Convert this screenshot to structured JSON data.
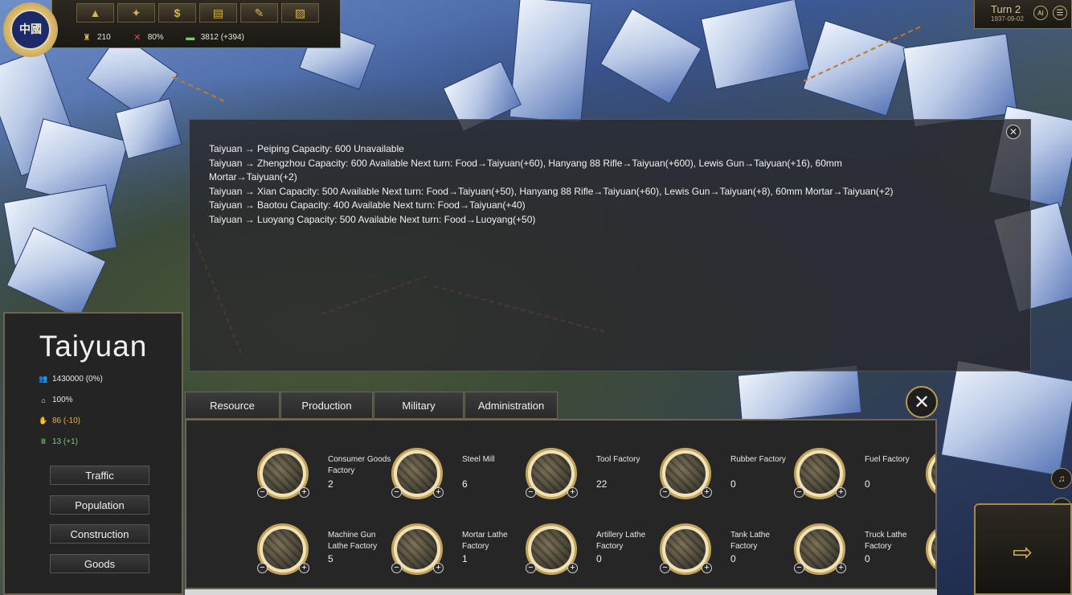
{
  "colors": {
    "gold": "#c3a35a",
    "food_warning": "#e8b04a",
    "positive_green": "#6fd36a",
    "panel_bg": "#262626"
  },
  "topbar": {
    "emblem_text": "中國",
    "icons": [
      "factory-icon",
      "eagle-icon",
      "dollar-icon",
      "map-icon",
      "hammer-icon",
      "chart-icon"
    ],
    "icon_glyphs": [
      "▲",
      "✦",
      "$",
      "▤",
      "✎",
      "▨"
    ],
    "stats": [
      {
        "icon": "industry-icon",
        "glyph": "♜",
        "value": "210"
      },
      {
        "icon": "crossed-swords-icon",
        "glyph": "✕",
        "value": "80%"
      },
      {
        "icon": "money-icon",
        "glyph": "▬",
        "value": "3812 (+394)"
      }
    ]
  },
  "turn": {
    "title": "Turn 2",
    "date": "1937-09-02",
    "ai_label": "AI",
    "menu_glyph": "☰"
  },
  "log": {
    "close_glyph": "✕",
    "lines": [
      "Taiyuan → Peiping  Capacity: 600  Unavailable",
      "Taiyuan → Zhengzhou  Capacity: 600  Available  Next turn: Food→Taiyuan(+60), Hanyang 88 Rifle→Taiyuan(+600), Lewis Gun→Taiyuan(+16), 60mm",
      "Mortar→Taiyuan(+2)",
      "Taiyuan → Xian  Capacity: 500  Available  Next turn: Food→Taiyuan(+50), Hanyang 88 Rifle→Taiyuan(+60), Lewis Gun→Taiyuan(+8), 60mm Mortar→Taiyuan(+2)",
      "Taiyuan → Baotou  Capacity: 400  Available  Next turn: Food→Taiyuan(+40)",
      "Taiyuan → Luoyang  Capacity: 500  Available  Next turn: Food→Luoyang(+50)"
    ]
  },
  "city": {
    "name": "Taiyuan",
    "stats": [
      {
        "icon": "population-icon",
        "glyph": "👥",
        "value": "1430000 (0%)",
        "color": "#e8e8e8"
      },
      {
        "icon": "loyalty-icon",
        "glyph": "⌂",
        "value": "100%",
        "color": "#e8e8e8"
      },
      {
        "icon": "food-icon",
        "glyph": "✋",
        "value": "86 (-10)",
        "color": "#e8b04a"
      },
      {
        "icon": "supply-icon",
        "glyph": "Ⅲ",
        "value": "13 (+1)",
        "color": "#6fd36a"
      }
    ],
    "buttons": [
      "Traffic",
      "Population",
      "Construction",
      "Goods"
    ]
  },
  "tabs": [
    "Resource",
    "Production",
    "Military",
    "Administration"
  ],
  "panel_close_glyph": "✕",
  "buildings": [
    {
      "name": "Consumer Goods Factory",
      "count": "2"
    },
    {
      "name": "Steel Mill",
      "count": "6"
    },
    {
      "name": "Tool Factory",
      "count": "22"
    },
    {
      "name": "Rubber Factory",
      "count": "0"
    },
    {
      "name": "Fuel Factory",
      "count": "0"
    },
    {
      "name": "Machine Gun Lathe Factory",
      "count": "5"
    },
    {
      "name": "Mortar Lathe Factory",
      "count": "1"
    },
    {
      "name": "Artillery Lathe Factory",
      "count": "0"
    },
    {
      "name": "Tank Lathe Factory",
      "count": "0"
    },
    {
      "name": "Truck Lathe Factory",
      "count": "0"
    }
  ],
  "end_turn": {
    "arrow_glyph": "⇨"
  },
  "side_buttons": [
    "♫",
    "⚙"
  ]
}
